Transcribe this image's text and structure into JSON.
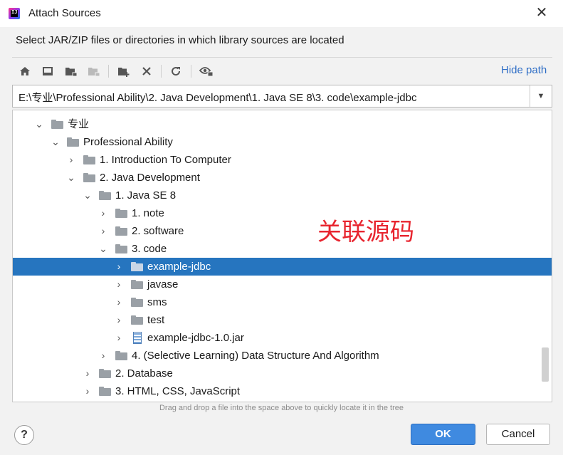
{
  "window": {
    "title": "Attach Sources",
    "close_glyph": "✕"
  },
  "description": "Select JAR/ZIP files or directories in which library sources are located",
  "toolbar": {
    "icons": [
      "home-icon",
      "desktop-icon",
      "project-folder-icon",
      "module-folder-icon",
      "new-folder-icon",
      "delete-icon",
      "refresh-icon",
      "show-hidden-icon"
    ],
    "hide_path_label": "Hide path"
  },
  "path": {
    "value": "E:\\专业\\Professional Ability\\2. Java Development\\1. Java SE 8\\3. code\\example-jdbc"
  },
  "tree": {
    "rows": [
      {
        "label": "专业",
        "expanded": true,
        "type": "folder"
      },
      {
        "label": "Professional Ability",
        "expanded": true,
        "type": "folder"
      },
      {
        "label": "1. Introduction To Computer",
        "expanded": false,
        "type": "folder"
      },
      {
        "label": "2. Java Development",
        "expanded": true,
        "type": "folder"
      },
      {
        "label": "1. Java SE 8",
        "expanded": true,
        "type": "folder"
      },
      {
        "label": "1. note",
        "expanded": false,
        "type": "folder"
      },
      {
        "label": "2. software",
        "expanded": false,
        "type": "folder"
      },
      {
        "label": "3. code",
        "expanded": true,
        "type": "folder"
      },
      {
        "label": "example-jdbc",
        "expanded": false,
        "type": "folder",
        "selected": true
      },
      {
        "label": "javase",
        "expanded": false,
        "type": "folder"
      },
      {
        "label": "sms",
        "expanded": false,
        "type": "folder"
      },
      {
        "label": "test",
        "expanded": false,
        "type": "folder"
      },
      {
        "label": "example-jdbc-1.0.jar",
        "expanded": false,
        "type": "jar"
      },
      {
        "label": "4. (Selective Learning) Data Structure And Algorithm",
        "expanded": false,
        "type": "folder"
      },
      {
        "label": "2. Database",
        "expanded": false,
        "type": "folder"
      },
      {
        "label": "3. HTML, CSS, JavaScript",
        "expanded": false,
        "type": "folder"
      }
    ],
    "annotation": "关联源码"
  },
  "hint": "Drag and drop a file into the space above to quickly locate it in the tree",
  "footer": {
    "help_label": "?",
    "ok_label": "OK",
    "cancel_label": "Cancel"
  },
  "colors": {
    "selection": "#2675bf",
    "link": "#2f6ec6",
    "primary_button": "#3f8ae0",
    "annotation": "#e8252f"
  }
}
